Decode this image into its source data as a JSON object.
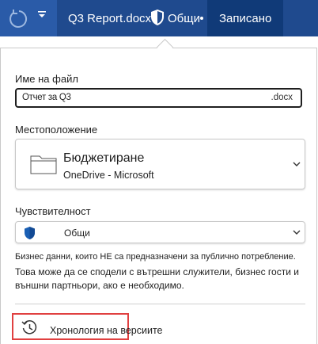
{
  "titlebar": {
    "document_title": "Q3 Report.docx",
    "sensitivity": "Общи",
    "status": "Записано",
    "colors": {
      "bar": "#1f4a8e",
      "saved": "#103a78",
      "accent": "#1a5fb4"
    },
    "icons": {
      "undo": "undo-icon",
      "quick_access": "quick-access-arrow-icon",
      "sensitivity": "shield-icon"
    }
  },
  "panel": {
    "filename": {
      "label": "Име на файл",
      "value": "Отчет за Q3",
      "extension": ".docx"
    },
    "location": {
      "label": "Местоположение",
      "folder": "Бюджетиране",
      "service": "OneDrive - Microsoft",
      "icon": "folder-icon"
    },
    "sensitivity": {
      "label": "Чувствителност",
      "selected": "Общи",
      "description_short": "Бизнес данни, които НЕ са предназначени за публично потребление.",
      "description_long": "Това може да се сподели с вътрешни служители, бизнес гости и външни партньори, ако е необходимо."
    },
    "version_history": {
      "label": "Хронология на версиите",
      "icon": "history-icon",
      "highlight_color": "#e04040"
    }
  }
}
